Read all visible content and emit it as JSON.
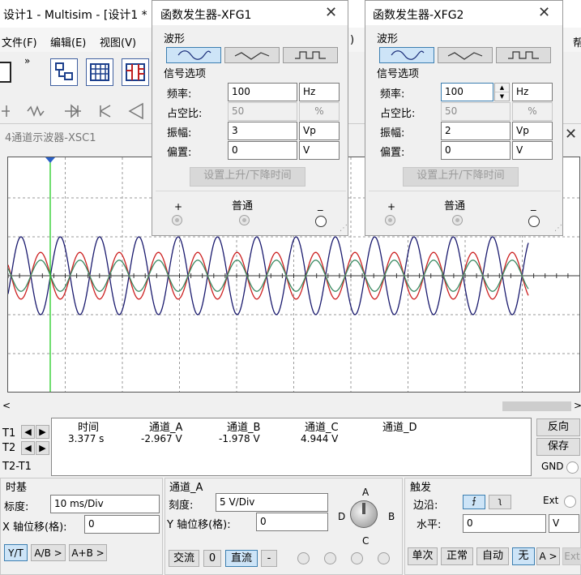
{
  "app": {
    "title": "设计1 - Multisim - [设计1 *",
    "menu": [
      "文件(F)",
      "编辑(E)",
      "视图(V)"
    ],
    "menu_right_glyph": ")",
    "menu_right_glyph2": "帮"
  },
  "scope": {
    "title": "4通道示波器-XSC1",
    "readout": {
      "headers": [
        "时间",
        "通道_A",
        "通道_B",
        "通道_C",
        "通道_D"
      ],
      "rows": [
        {
          "label": "T1",
          "time": "3.377 s",
          "a": "-2.967 V",
          "b": "-1.978 V",
          "c": "4.944 V",
          "d": ""
        },
        {
          "label": "T2",
          "time": "",
          "a": "",
          "b": "",
          "c": "",
          "d": ""
        },
        {
          "label": "T2-T1",
          "time": "",
          "a": "",
          "b": "",
          "c": "",
          "d": ""
        }
      ]
    },
    "reverse_label": "反向",
    "save_label": "保存",
    "gnd_label": "GND",
    "timebase": {
      "title": "时基",
      "scale_label": "标度:",
      "scale_value": "10 ms/Div",
      "xpos_label": "X 轴位移(格):",
      "xpos_value": "0",
      "buttons": [
        "Y/T",
        "A/B >",
        "A+B >"
      ]
    },
    "channel": {
      "title": "通道_A",
      "scale_label": "刻度:",
      "scale_value": "5  V/Div",
      "ypos_label": "Y 轴位移(格):",
      "ypos_value": "0",
      "knob_labels": {
        "a": "A",
        "b": "B",
        "c": "C",
        "d": "D"
      },
      "coupling": [
        "交流",
        "0",
        "直流",
        "-"
      ]
    },
    "trigger": {
      "title": "触发",
      "edge_label": "边沿:",
      "ext_label": "Ext",
      "level_label": "水平:",
      "level_value": "0",
      "level_unit": "V",
      "modes": [
        "单次",
        "正常",
        "自动",
        "无",
        "A >",
        "Ext"
      ]
    },
    "waves": {
      "a_amp": 3,
      "b_amp": 2,
      "c_amp": 5,
      "freq_hz": 100,
      "colors": {
        "a": "#cc2020",
        "b": "#3a8a62",
        "c": "#1a1a6e",
        "cursor": "#22cc22"
      }
    }
  },
  "fg1": {
    "title": "函数发生器-XFG1",
    "waveform_label": "波形",
    "signal_label": "信号选项",
    "fields": [
      {
        "label": "频率:",
        "value": "100",
        "unit": "Hz",
        "enabled": true
      },
      {
        "label": "占空比:",
        "value": "50",
        "unit": "%",
        "enabled": false
      },
      {
        "label": "振幅:",
        "value": "3",
        "unit": "Vp",
        "enabled": true
      },
      {
        "label": "偏置:",
        "value": "0",
        "unit": "V",
        "enabled": true
      }
    ],
    "rise_fall_label": "设置上升/下降时间",
    "plus": "+",
    "common": "普通",
    "minus": "_"
  },
  "fg2": {
    "title": "函数发生器-XFG2",
    "waveform_label": "波形",
    "signal_label": "信号选项",
    "fields": [
      {
        "label": "频率:",
        "value": "100",
        "unit": "Hz",
        "enabled": true
      },
      {
        "label": "占空比:",
        "value": "50",
        "unit": "%",
        "enabled": false
      },
      {
        "label": "振幅:",
        "value": "2",
        "unit": "Vp",
        "enabled": true
      },
      {
        "label": "偏置:",
        "value": "0",
        "unit": "V",
        "enabled": true
      }
    ],
    "rise_fall_label": "设置上升/下降时间",
    "plus": "+",
    "common": "普通",
    "minus": "_"
  }
}
